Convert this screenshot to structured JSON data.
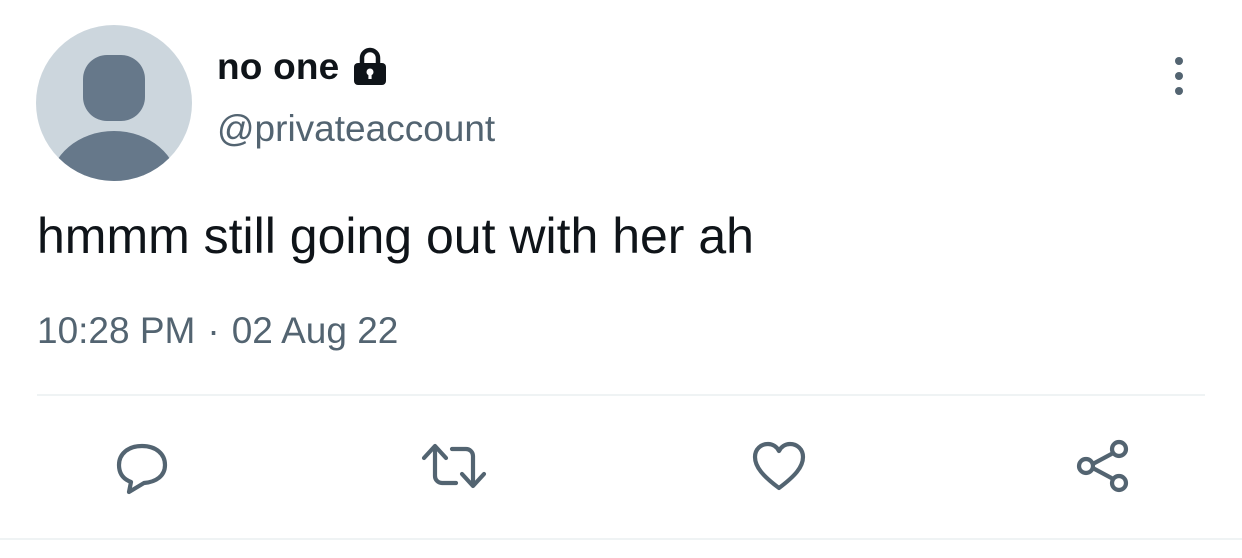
{
  "tweet": {
    "author": {
      "display_name": "no one",
      "handle": "@privateaccount",
      "protected_icon": "lock-icon",
      "avatar_icon": "default-profile-avatar"
    },
    "text": "hmmm still going out with her ah",
    "time": "10:28 PM",
    "separator": "·",
    "date": "02 Aug 22"
  },
  "menu": {
    "more_icon": "more-vertical-icon"
  },
  "actions": [
    {
      "name": "reply",
      "icon": "reply-icon"
    },
    {
      "name": "retweet",
      "icon": "retweet-icon"
    },
    {
      "name": "like",
      "icon": "heart-icon"
    },
    {
      "name": "share",
      "icon": "share-icon"
    }
  ],
  "colors": {
    "primary_text": "#0f1419",
    "secondary_text": "#536471",
    "avatar_bg": "#ccd6dd",
    "avatar_fg": "#66788a",
    "icon": "#536471",
    "divider": "#eff3f4"
  }
}
